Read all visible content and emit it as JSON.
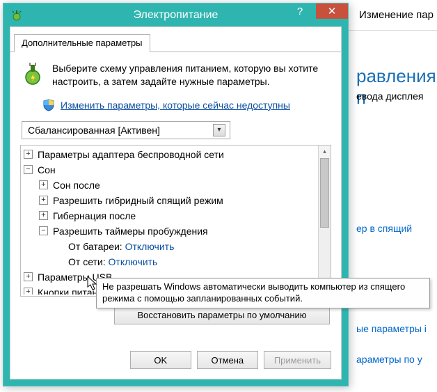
{
  "bg": {
    "titlebar_fragment": "Изменение пар",
    "heading_fragment": "равления п",
    "text_fragment": "евода дисплея",
    "link1_fragment": "ер в спящий",
    "link2_fragment": "ые параметры і",
    "link3_fragment": "араметры по у"
  },
  "dialog": {
    "title": "Электропитание",
    "help_glyph": "?",
    "close_glyph": "✕",
    "tab_label": "Дополнительные параметры",
    "intro_text": "Выберите схему управления питанием, которую вы хотите настроить, а затем задайте нужные параметры.",
    "shield_link": "Изменить параметры, которые сейчас недоступны",
    "scheme_selected": "Сбалансированная [Активен]",
    "restore_label": "Восстановить параметры по умолчанию",
    "ok_label": "OK",
    "cancel_label": "Отмена",
    "apply_label": "Применить"
  },
  "tree": {
    "wireless": "Параметры адаптера беспроводной сети",
    "sleep": "Сон",
    "sleep_after": "Сон после",
    "hybrid_sleep": "Разрешить гибридный спящий режим",
    "hibernate_after": "Гибернация после",
    "wake_timers": "Разрешить таймеры пробуждения",
    "battery_label": "От батареи:",
    "battery_value": "Отключить",
    "plugged_label": "От сети:",
    "plugged_value": "Отключить",
    "usb": "Параметры USB",
    "power_buttons": "Кнопки питан"
  },
  "tooltip_text": "Не разрешать Windows автоматически выводить компьютер из спящего режима с помощью запланированных событий."
}
